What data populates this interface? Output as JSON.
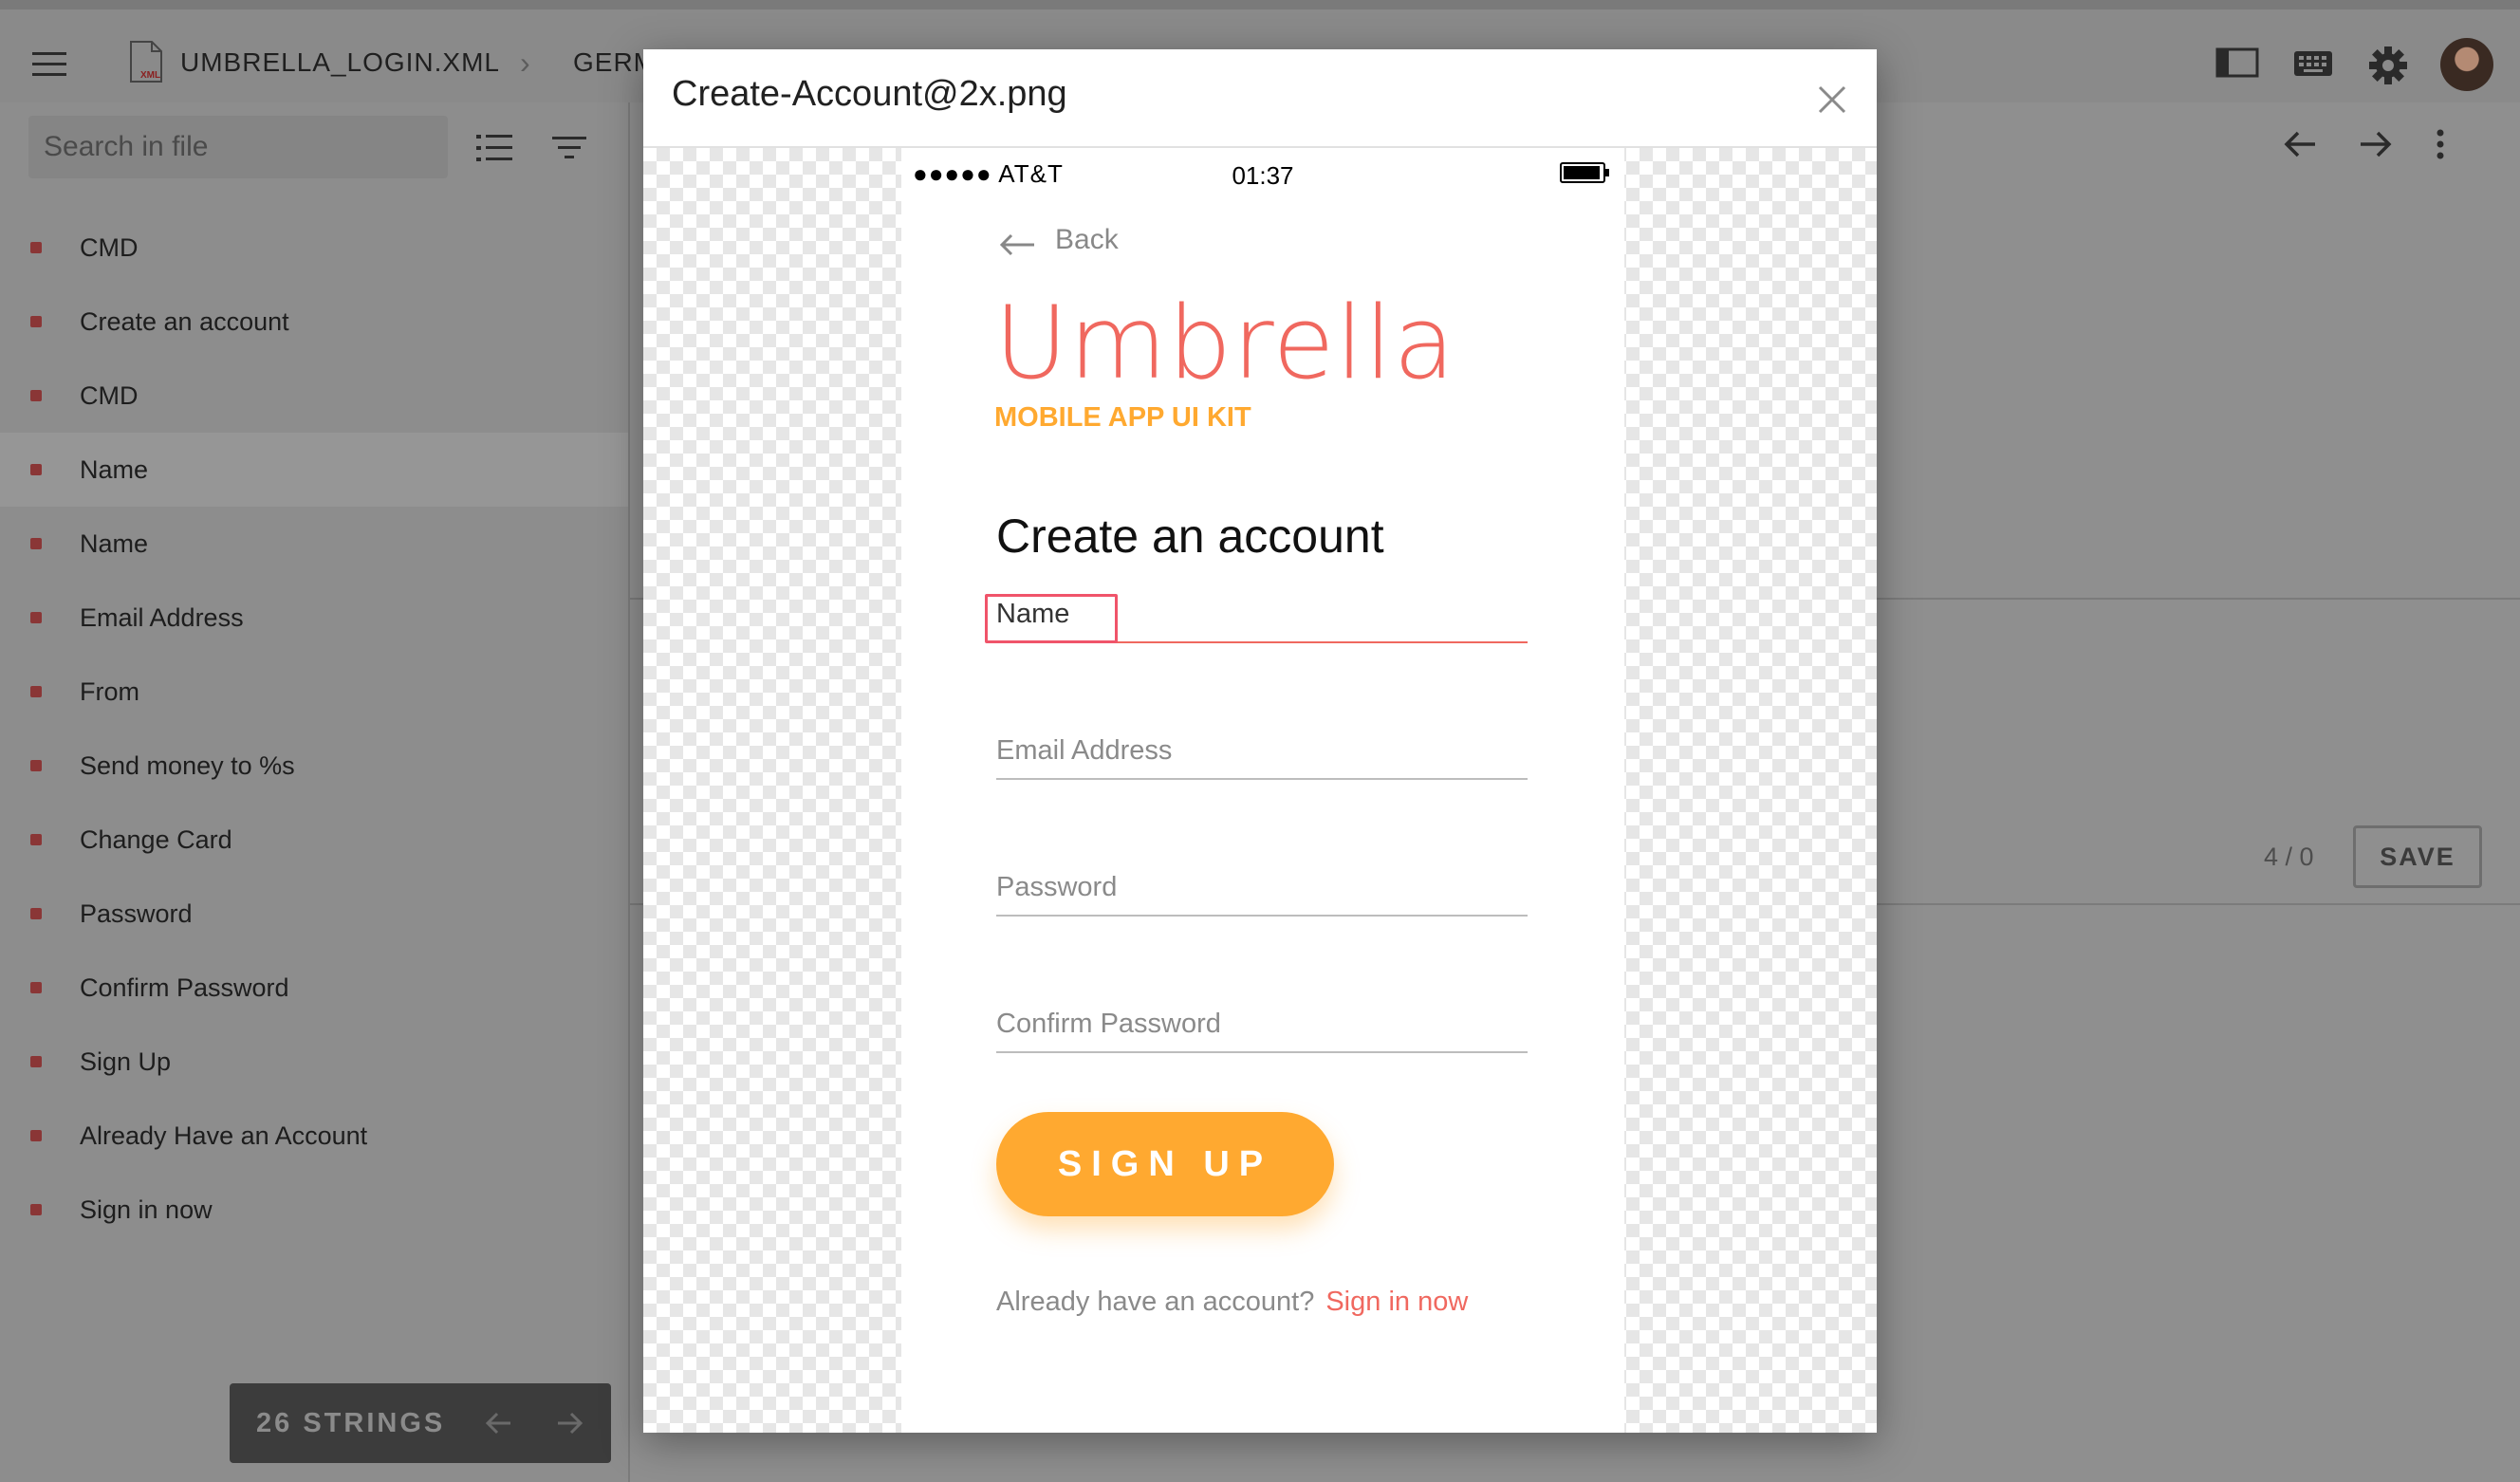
{
  "topbar": {
    "file_name": "UMBRELLA_LOGIN.XML",
    "breadcrumb_sep": "›",
    "language": "GERM"
  },
  "sidebar": {
    "search_placeholder": "Search in file",
    "items": [
      {
        "label": "CMD"
      },
      {
        "label": "Create an account"
      },
      {
        "label": "CMD"
      },
      {
        "label": "Name"
      },
      {
        "label": "Name"
      },
      {
        "label": "Email Address"
      },
      {
        "label": "From"
      },
      {
        "label": "Send money to %s"
      },
      {
        "label": "Change Card"
      },
      {
        "label": "Password"
      },
      {
        "label": "Confirm Password"
      },
      {
        "label": "Sign Up"
      },
      {
        "label": "Already Have an Account"
      },
      {
        "label": "Sign in now"
      }
    ],
    "active_index": 3,
    "count_label": "26 STRINGS"
  },
  "editor": {
    "char_count": "4 / 0",
    "save_label": "SAVE"
  },
  "modal": {
    "title": "Create-Account@2x.png",
    "phone": {
      "carrier": "●●●●● AT&T",
      "time": "01:37",
      "back_label": "Back",
      "brand_title": "Umbrella",
      "brand_subtitle": "MOBILE APP UI KIT",
      "heading": "Create an account",
      "fields": {
        "name": "Name",
        "email": "Email Address",
        "password": "Password",
        "confirm": "Confirm Password"
      },
      "signup_label": "SIGN UP",
      "already_q": "Already have an account?",
      "signin_link": "Sign in now"
    }
  },
  "colors": {
    "brand_red": "#f0685f",
    "brand_orange": "#ffa930",
    "highlight": "#f0546a"
  }
}
